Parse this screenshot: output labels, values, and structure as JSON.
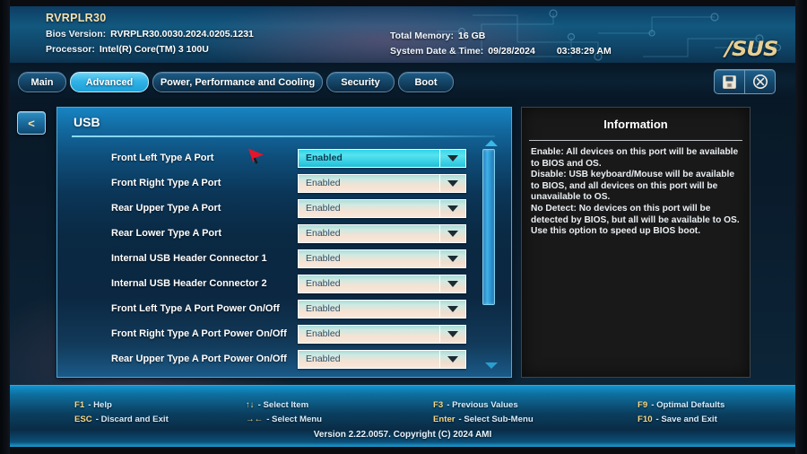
{
  "header": {
    "board_name": "RVRPLR30",
    "bios_version_label": "Bios Version:",
    "bios_version_value": "RVRPLR30.0030.2024.0205.1231",
    "processor_label": "Processor:",
    "processor_value": "Intel(R) Core(TM) 3 100U",
    "total_memory_label": "Total Memory:",
    "total_memory_value": "16 GB",
    "datetime_label": "System Date & Time:",
    "date_value": "09/28/2024",
    "time_value": "03:38:29 AM",
    "brand_logo": "/SUS"
  },
  "tabs": [
    {
      "label": "Main",
      "active": false
    },
    {
      "label": "Advanced",
      "active": true
    },
    {
      "label": "Power, Performance and Cooling",
      "active": false
    },
    {
      "label": "Security",
      "active": false
    },
    {
      "label": "Boot",
      "active": false
    }
  ],
  "toolbar": {
    "save_icon": "floppy-disk-icon",
    "exit_icon": "close-circle-icon"
  },
  "back_button": {
    "label": "<"
  },
  "main": {
    "section_title": "USB",
    "rows": [
      {
        "label": "Front Left Type A Port",
        "value": "Enabled",
        "selected": true
      },
      {
        "label": "Front Right Type A Port",
        "value": "Enabled",
        "selected": false
      },
      {
        "label": "Rear Upper Type A Port",
        "value": "Enabled",
        "selected": false
      },
      {
        "label": "Rear Lower Type A Port",
        "value": "Enabled",
        "selected": false
      },
      {
        "label": "Internal USB Header Connector 1",
        "value": "Enabled",
        "selected": false
      },
      {
        "label": "Internal USB Header Connector 2",
        "value": "Enabled",
        "selected": false
      },
      {
        "label": "Front Left Type A Port Power On/Off",
        "value": "Enabled",
        "selected": false
      },
      {
        "label": "Front Right Type A Port Power On/Off",
        "value": "Enabled",
        "selected": false
      },
      {
        "label": "Rear Upper Type A Port Power On/Off",
        "value": "Enabled",
        "selected": false
      }
    ]
  },
  "info": {
    "title": "Information",
    "text": "Enable: All devices on this port will be available to BIOS and OS.\nDisable: USB keyboard/Mouse will be available to BIOS, and all devices on this port will be unavailable to OS.\nNo Detect: No devices on this port will be detected by BIOS, but all will be available to OS. Use this option to speed up BIOS boot."
  },
  "footer": {
    "hotkeys": [
      {
        "key": "F1",
        "desc": "- Help"
      },
      {
        "key": "ESC",
        "desc": "- Discard and Exit"
      },
      {
        "key": "↑↓",
        "desc": "- Select Item"
      },
      {
        "key": "→←",
        "desc": "- Select Menu"
      },
      {
        "key": "F3",
        "desc": "- Previous Values"
      },
      {
        "key": "Enter",
        "desc": "- Select Sub-Menu"
      },
      {
        "key": "F9",
        "desc": "- Optimal Defaults"
      },
      {
        "key": "F10",
        "desc": "- Save and Exit"
      }
    ],
    "version": "Version 2.22.0057. Copyright (C) 2024 AMI"
  },
  "colors": {
    "accent": "#31b3e6",
    "header_blue": "#12587f",
    "panel_dark": "#0a2943",
    "info_bg": "#191919",
    "key_gold": "#f6d88a",
    "cursor_red": "#e8142a"
  }
}
